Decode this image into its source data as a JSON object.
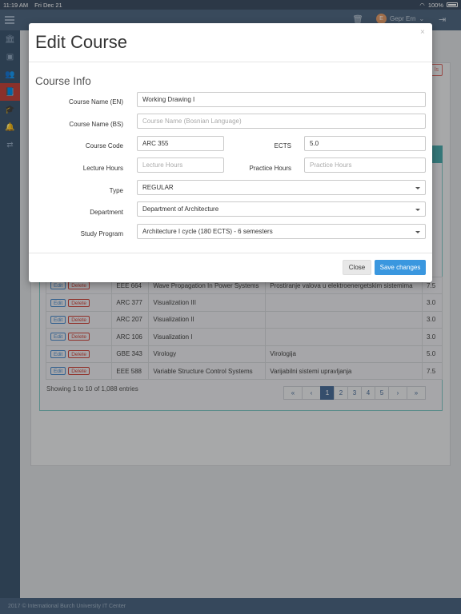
{
  "statusbar": {
    "time": "11:19 AM",
    "date": "Fri Dec 21",
    "battery": "100%"
  },
  "navbar": {
    "user_initial": "E",
    "user_name": "Gepr Ern"
  },
  "table": {
    "rows": [
      {
        "code": "EEE 664",
        "name": "Wave Propagation In Power Systems",
        "name_bs": "Prostiranje valova u elektroenergetskim sistemima",
        "ects": "7.5"
      },
      {
        "code": "ARC 377",
        "name": "Visualization III",
        "name_bs": "",
        "ects": "3.0"
      },
      {
        "code": "ARC 207",
        "name": "Visualization II",
        "name_bs": "",
        "ects": "3.0"
      },
      {
        "code": "ARC 106",
        "name": "Visualization I",
        "name_bs": "",
        "ects": "3.0"
      },
      {
        "code": "GBE 343",
        "name": "Virology",
        "name_bs": "Virologija",
        "ects": "5.0"
      },
      {
        "code": "EEE 588",
        "name": "Variable Structure Control Systems",
        "name_bs": "Varijabilni sistemi upravljanja",
        "ects": "7.5"
      }
    ],
    "edit_label": "Edit",
    "delete_label": "Delete",
    "entries_info": "Showing 1 to 10 of 1,088 entries",
    "pagination": [
      "«",
      "‹",
      "1",
      "2",
      "3",
      "4",
      "5",
      "›",
      "»"
    ],
    "active_page": "1",
    "bg_button_partial": "ls"
  },
  "footer": {
    "text": "2017 © International Burch University IT Center"
  },
  "modal": {
    "title": "Edit Course",
    "close_x": "×",
    "section": "Course Info",
    "fields": {
      "course_name_en": {
        "label": "Course Name (EN)",
        "value": "Working Drawing I"
      },
      "course_name_bs": {
        "label": "Course Name (BS)",
        "placeholder": "Course Name (Bosnian Language)"
      },
      "course_code": {
        "label": "Course Code",
        "value": "ARC 355"
      },
      "ects": {
        "label": "ECTS",
        "value": "5.0"
      },
      "lecture_hours": {
        "label": "Lecture Hours",
        "placeholder": "Lecture Hours"
      },
      "practice_hours": {
        "label": "Practice Hours",
        "placeholder": "Practice Hours"
      },
      "type": {
        "label": "Type",
        "value": "REGULAR"
      },
      "department": {
        "label": "Department",
        "value": "Department of Architecture"
      },
      "study_program": {
        "label": "Study Program",
        "value": "Architecture I cycle (180 ECTS) - 6 semesters"
      }
    },
    "close_button": "Close",
    "save_button": "Save changes"
  }
}
